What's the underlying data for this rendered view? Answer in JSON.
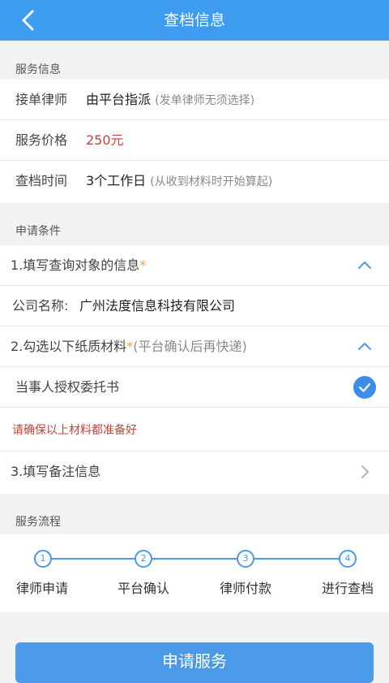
{
  "header": {
    "title": "查档信息"
  },
  "service_info": {
    "section_label": "服务信息",
    "lawyer_label": "接单律师",
    "lawyer_value": "由平台指派",
    "lawyer_hint": "(发单律师无须选择)",
    "price_label": "服务价格",
    "price_value": "250元",
    "time_label": "查档时间",
    "time_value": "3个工作日",
    "time_hint": "(从收到材料时开始算起)"
  },
  "conditions": {
    "section_label": "申请条件",
    "step1_title": "1.填写查询对象的信息",
    "star": "*",
    "company_label": "公司名称:",
    "company_value": "广州法度信息科技有限公司",
    "step2_title": "2.勾选以下纸质材料",
    "step2_hint": "(平台确认后再快递)",
    "material_item": "当事人授权委托书",
    "warning": "请确保以上材料都准备好",
    "step3_title": "3.填写备注信息"
  },
  "process": {
    "section_label": "服务流程",
    "steps": [
      {
        "num": "1",
        "label": "律师申请"
      },
      {
        "num": "2",
        "label": "平台确认"
      },
      {
        "num": "3",
        "label": "律师付款"
      },
      {
        "num": "4",
        "label": "进行查档"
      }
    ]
  },
  "submit_label": "申请服务",
  "colors": {
    "accent": "#3d9bf0",
    "price": "#c8413b",
    "required": "#f3a33a"
  }
}
